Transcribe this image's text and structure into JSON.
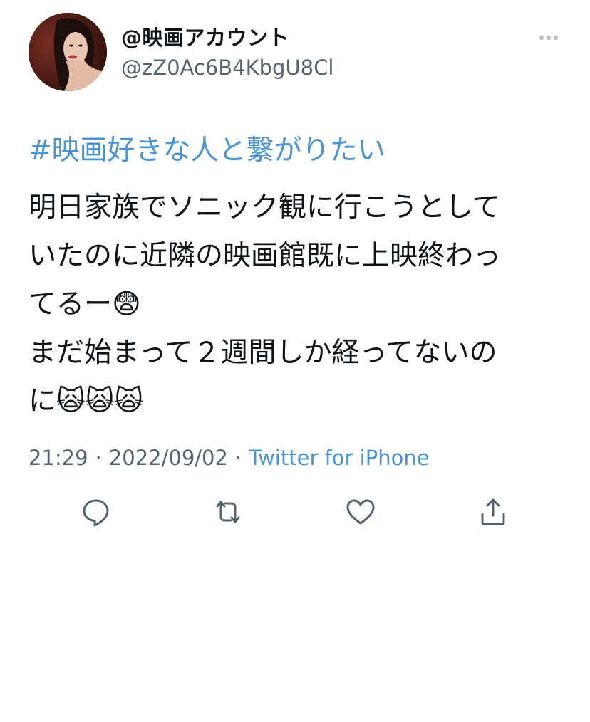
{
  "user": {
    "display_name": "@映画アカウント",
    "handle": "@zZ0Ac6B4KbgU8Cl",
    "avatar_icon": "profile-photo"
  },
  "tweet": {
    "hashtag": "#映画好きな人と繋がりたい",
    "lines": [
      "明日家族でソニック観に行こうとして",
      "いたのに近隣の映画館既に上映終わっ",
      "てるー😨",
      "まだ始まって２週間しか経ってないの",
      "に🙀🙀🙀"
    ]
  },
  "meta": {
    "time": "21:29",
    "separator": "·",
    "date": "2022/09/02",
    "source": "Twitter for iPhone"
  },
  "actions": {
    "reply_icon": "reply-icon",
    "retweet_icon": "retweet-icon",
    "like_icon": "like-icon",
    "share_icon": "share-icon"
  },
  "colors": {
    "link": "#4a94d3",
    "secondary": "#536471",
    "text": "#0f1419"
  }
}
